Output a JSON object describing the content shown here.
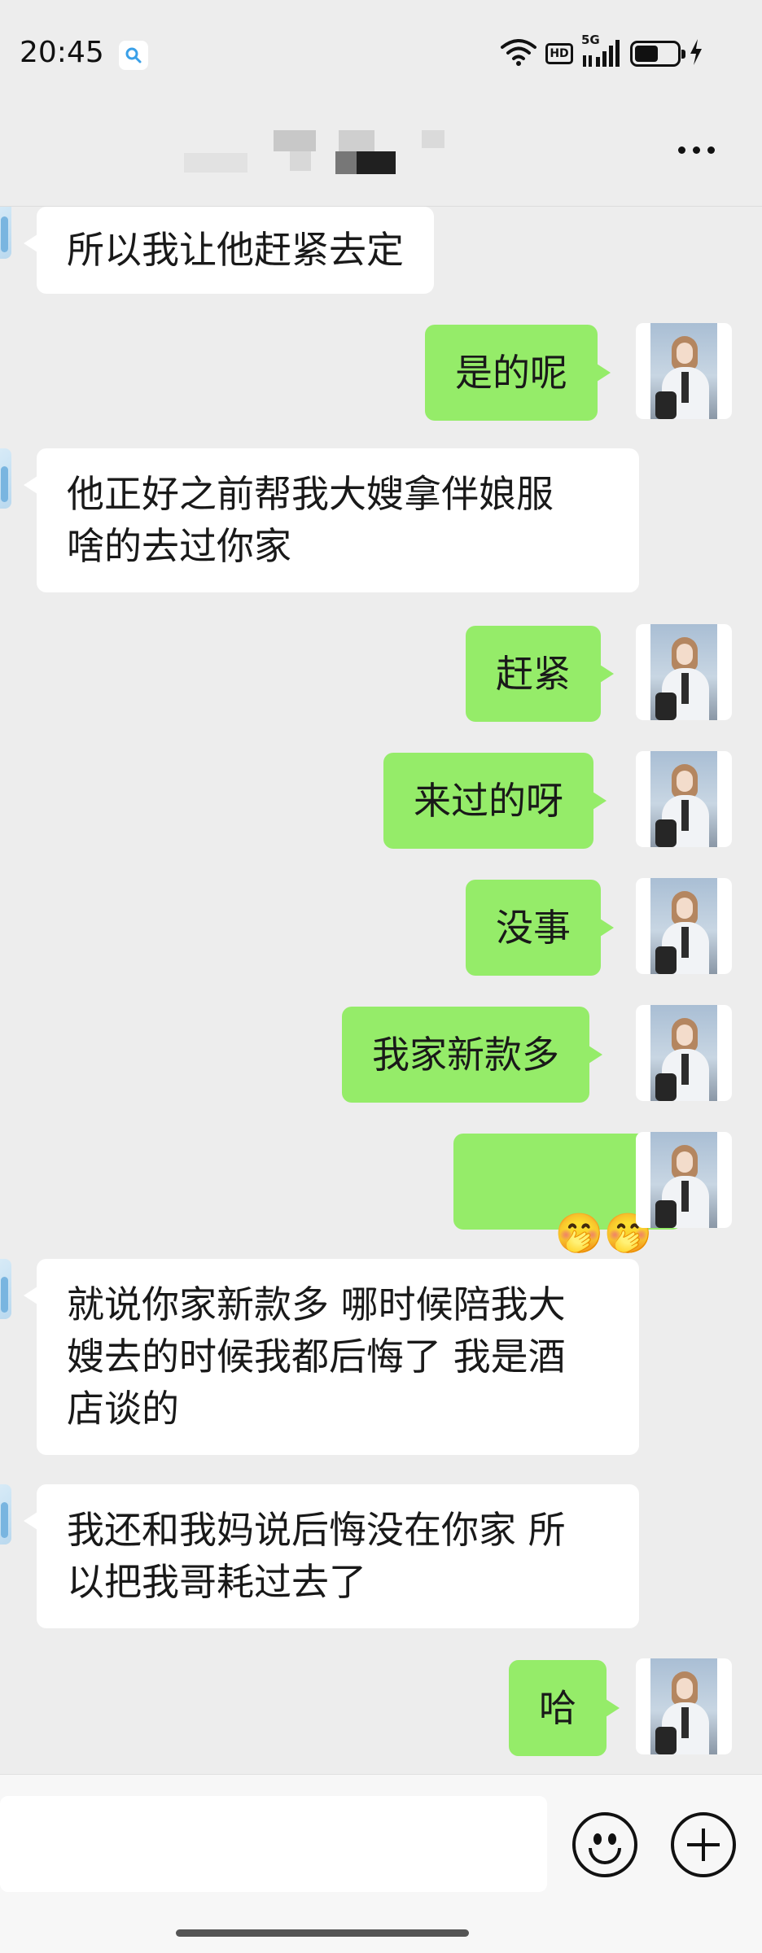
{
  "status_bar": {
    "time": "20:45",
    "app_icon": "search-icon",
    "hd_label": "HD",
    "network_label": "5G",
    "battery_level_percent": 55,
    "charging": true
  },
  "title_bar": {
    "title_obscured": true,
    "menu_icon": "more-icon"
  },
  "messages": [
    {
      "side": "in",
      "text": "所以我让他赶紧去定"
    },
    {
      "side": "out",
      "text": "是的呢"
    },
    {
      "side": "in",
      "text": "他正好之前帮我大嫂拿伴娘服\n啥的去过你家"
    },
    {
      "side": "out",
      "text": "赶紧"
    },
    {
      "side": "out",
      "text": "来过的呀"
    },
    {
      "side": "out",
      "text": "没事"
    },
    {
      "side": "out",
      "text": "我家新款多"
    },
    {
      "side": "out",
      "text": "🤭🤭"
    },
    {
      "side": "in",
      "text": "就说你家新款多 哪时候陪我大\n嫂去的时候我都后悔了 我是酒\n店谈的"
    },
    {
      "side": "in",
      "text": "我还和我妈说后悔没在你家 所\n以把我哥耗过去了"
    },
    {
      "side": "out",
      "text": "哈"
    }
  ],
  "input_bar": {
    "placeholder": "",
    "emoji_icon": "smiley-icon",
    "plus_icon": "plus-icon"
  },
  "colors": {
    "background": "#ededed",
    "outgoing_bubble": "#95ec69",
    "incoming_bubble": "#ffffff"
  }
}
